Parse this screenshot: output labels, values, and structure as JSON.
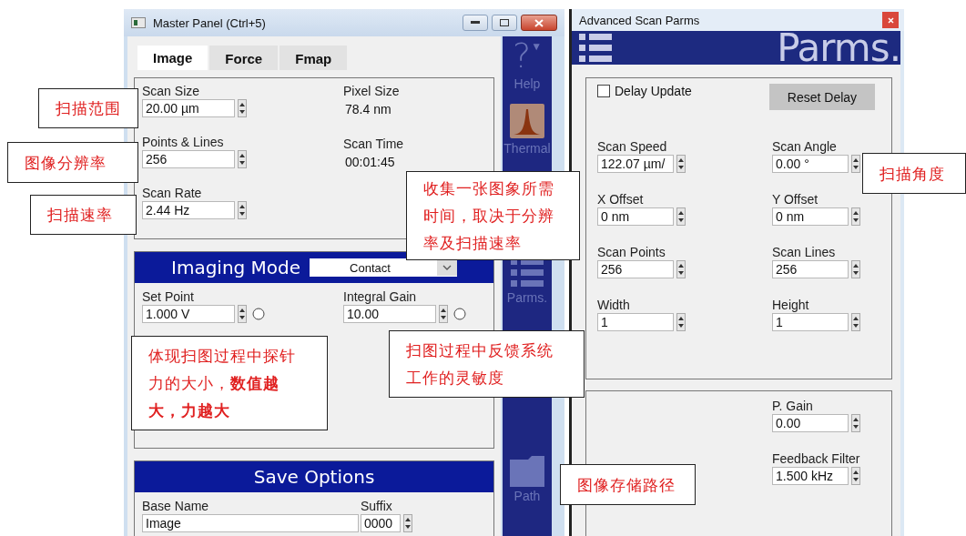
{
  "master_panel": {
    "title": "Master Panel (Ctrl+5)",
    "tabs": [
      {
        "label": "Image",
        "selected": true
      },
      {
        "label": "Force",
        "selected": false
      },
      {
        "label": "Fmap",
        "selected": false
      }
    ],
    "image_tab": {
      "columns": [
        [
          {
            "label": "Scan Size",
            "value": "20.00 µm",
            "kind": "spin"
          },
          {
            "label": "Points & Lines",
            "value": "256",
            "kind": "spin"
          },
          {
            "label": "Scan Rate",
            "value": "2.44 Hz",
            "kind": "spin"
          }
        ],
        [
          {
            "label": "Pixel Size",
            "value": "78.4 nm",
            "kind": "readout"
          },
          {
            "label": "Scan Time",
            "value": "00:01:45",
            "kind": "readout"
          }
        ]
      ]
    },
    "imaging_mode": {
      "title": "Imaging Mode",
      "mode": "Contact",
      "fields": [
        {
          "label": "Set Point",
          "value": "1.000 V",
          "radio_selected": false
        },
        {
          "label": "Integral Gain",
          "value": "10.00",
          "radio_selected": false
        }
      ]
    },
    "save_options": {
      "title": "Save Options",
      "fields": [
        {
          "label": "Base Name",
          "value": "Image",
          "kind": "text"
        },
        {
          "label": "Suffix",
          "value": "0000",
          "kind": "spin"
        }
      ]
    },
    "sidebar": [
      {
        "kind": "help",
        "glyph": "?",
        "caret": "▼",
        "label": "Help"
      },
      {
        "kind": "thermal",
        "label": "Thermal"
      },
      {
        "kind": "list",
        "label": "Parms."
      },
      {
        "kind": "folder",
        "label": "Path"
      }
    ]
  },
  "advanced_scan_parms": {
    "title": "Advanced Scan Parms",
    "header_title": "Parms.",
    "delay_update": {
      "label": "Delay Update",
      "checked": false
    },
    "reset_button": "Reset Delay",
    "fields": [
      {
        "label": "Scan Speed",
        "value": "122.07 µm/"
      },
      {
        "label": "Scan Angle",
        "value": "0.00 °"
      },
      {
        "label": "X Offset",
        "value": "0 nm"
      },
      {
        "label": "Y Offset",
        "value": "0 nm"
      },
      {
        "label": "Scan Points",
        "value": "256"
      },
      {
        "label": "Scan Lines",
        "value": "256"
      },
      {
        "label": "Width",
        "value": "1"
      },
      {
        "label": "Height",
        "value": "1"
      }
    ],
    "gain_fields": [
      {
        "label": "P. Gain",
        "value": "0.00"
      },
      {
        "label": "Feedback Filter",
        "value": "1.500 kHz"
      }
    ]
  },
  "annotations": [
    {
      "text": "扫描范围"
    },
    {
      "text": "图像分辨率"
    },
    {
      "text": "扫描速率"
    },
    {
      "text": "收集一张图象所需时间，取决于分辨率及扫描速率"
    },
    {
      "text": "体现扫图过程中探针力的大小，**数值越大，力越大**"
    },
    {
      "text": "扫图过程中反馈系统工作的灵敏度"
    },
    {
      "text": "扫描角度"
    },
    {
      "text": "图像存储路径"
    }
  ]
}
